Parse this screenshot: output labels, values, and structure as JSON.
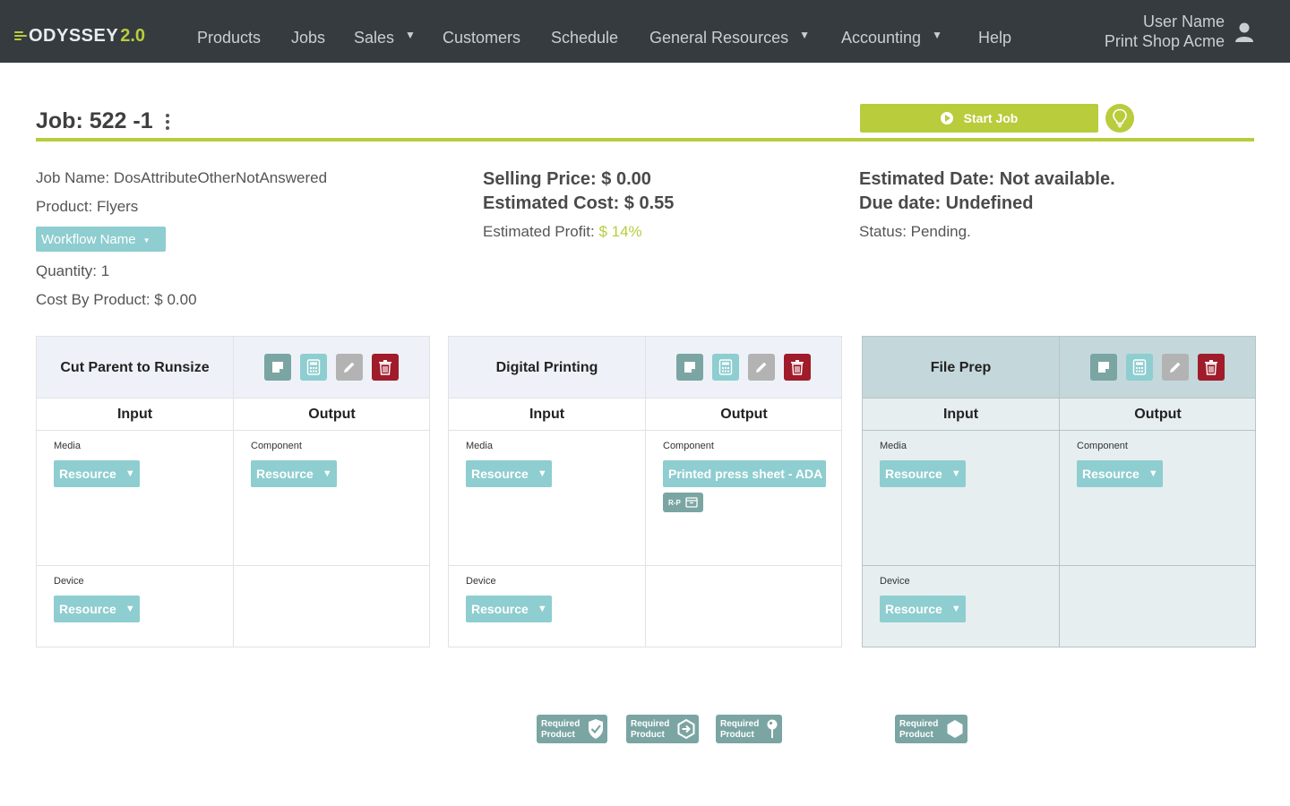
{
  "nav": {
    "logo_text": "ODYSSEY",
    "logo_version": "2.0",
    "items": [
      {
        "label": "Products",
        "dropdown": false
      },
      {
        "label": "Jobs",
        "dropdown": false
      },
      {
        "label": "Sales",
        "dropdown": true
      },
      {
        "label": "Customers",
        "dropdown": false
      },
      {
        "label": "Schedule",
        "dropdown": false
      },
      {
        "label": "General Resources",
        "dropdown": true
      },
      {
        "label": "Accounting",
        "dropdown": true
      },
      {
        "label": "Help",
        "dropdown": false
      }
    ],
    "user_name": "User Name",
    "shop_name": "Print Shop Acme",
    "user_icon": "person-icon"
  },
  "job": {
    "title": "Job: 522 -1",
    "start_label": "Start Job",
    "job_name": "Job Name: DosAttributeOtherNotAnswered",
    "product": "Product: Flyers",
    "workflow_label": "Workflow Name",
    "quantity": "Quantity: 1",
    "cost_by_product": "Cost By Product: $ 0.00",
    "selling_price": "Selling Price: $ 0.00",
    "estimated_cost": "Estimated Cost: $ 0.55",
    "estimated_profit_label": "Estimated Profit:",
    "estimated_profit_value": "$ 14%",
    "estimated_date": "Estimated Date: Not available.",
    "due_date": "Due date: Undefined",
    "status": "Status: Pending."
  },
  "colors": {
    "accent": "#b8cc3c",
    "navbar": "#363b40",
    "resource": "#8ecdd0",
    "note_tool": "#7aa5a3",
    "edit_tool": "#b3b3b3",
    "delete_tool": "#a01c2a"
  },
  "panels": [
    {
      "title": "Cut Parent to Runsize",
      "input_header": "Input",
      "output_header": "Output",
      "input_section_1": "Media",
      "input_resource_1": "Resource",
      "output_section": "Component",
      "output_resource": "Resource",
      "input_section_2": "Device",
      "input_resource_2": "Resource"
    },
    {
      "title": "Digital Printing",
      "input_header": "Input",
      "output_header": "Output",
      "input_section_1": "Media",
      "input_resource_1": "Resource",
      "output_section": "Component",
      "output_resource": "Printed press sheet - ADA",
      "output_tag": "R-P",
      "input_section_2": "Device",
      "input_resource_2": "Resource"
    },
    {
      "title": "File Prep",
      "input_header": "Input",
      "output_header": "Output",
      "input_section_1": "Media",
      "input_resource_1": "Resource",
      "output_section": "Component",
      "output_resource": "Resource",
      "input_section_2": "Device",
      "input_resource_2": "Resource"
    }
  ],
  "required_badges": [
    {
      "line1": "Required",
      "line2": "Product",
      "icon": "check-shield-icon"
    },
    {
      "line1": "Required",
      "line2": "Product",
      "icon": "arrow-hexagon-icon"
    },
    {
      "line1": "Required",
      "line2": "Product",
      "icon": "pin-icon"
    },
    {
      "line1": "Required",
      "line2": "Product",
      "icon": "hexagon-icon"
    }
  ]
}
